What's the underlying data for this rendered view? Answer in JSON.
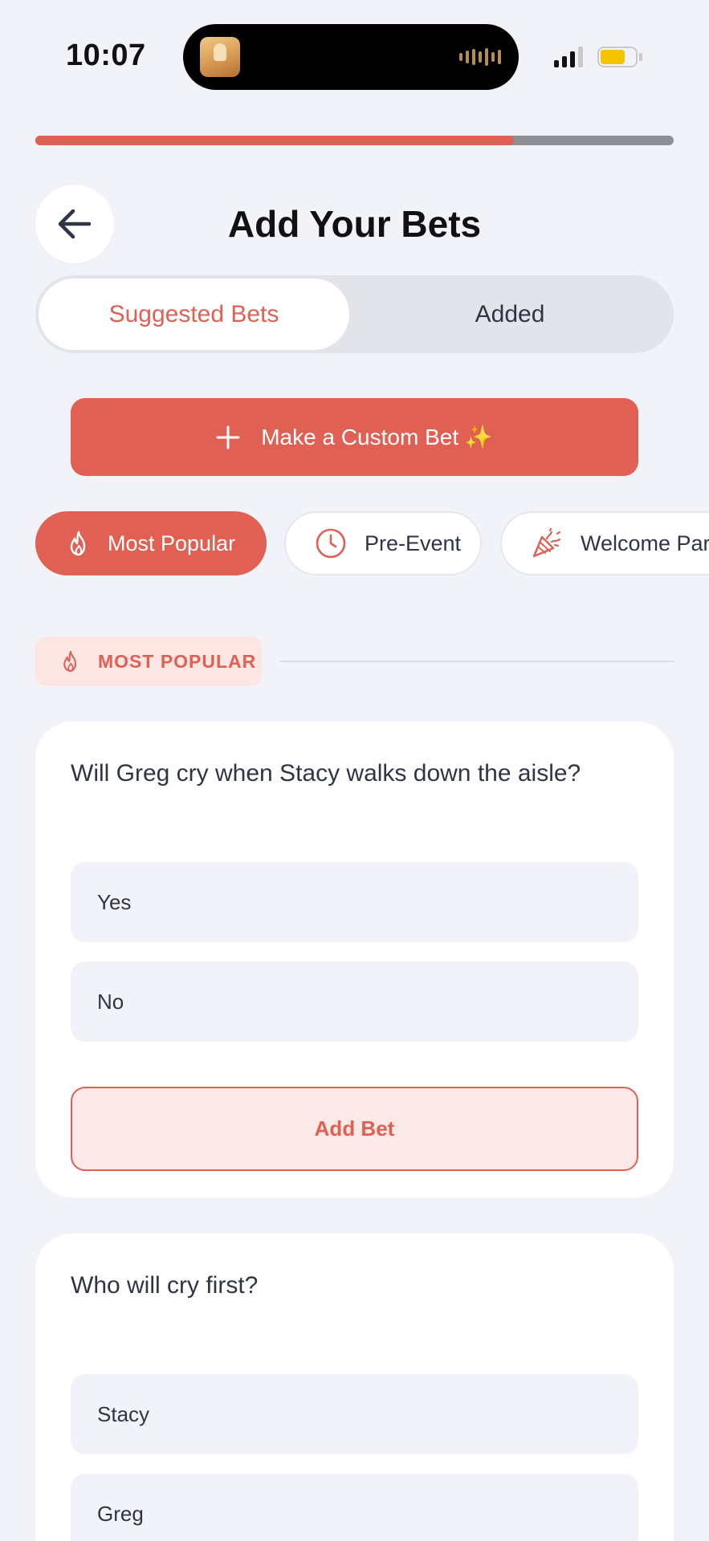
{
  "status_bar": {
    "time": "10:07",
    "battery_color": "#f5c400"
  },
  "progress": {
    "fraction": 0.75,
    "color": "#e06053"
  },
  "header": {
    "title": "Add Your Bets",
    "back_icon": "arrow-left-icon"
  },
  "tabs": [
    {
      "label": "Suggested Bets",
      "active": true
    },
    {
      "label": "Added",
      "active": false
    }
  ],
  "custom_bet": {
    "label": "Make a Custom Bet ✨",
    "icon": "plus-icon"
  },
  "categories": [
    {
      "label": "Most Popular",
      "icon": "flame-icon",
      "active": true
    },
    {
      "label": "Pre-Event",
      "icon": "clock-icon",
      "active": false
    },
    {
      "label": "Welcome Party",
      "icon": "party-popper-icon",
      "active": false
    }
  ],
  "section": {
    "label": "MOST POPULAR",
    "icon": "flame-icon"
  },
  "bets": [
    {
      "question": "Will Greg cry when Stacy walks down the aisle?",
      "options": [
        "Yes",
        "No"
      ],
      "add_label": "Add Bet"
    },
    {
      "question": "Who will cry first?",
      "options": [
        "Stacy",
        "Greg"
      ]
    }
  ],
  "colors": {
    "accent": "#e06053",
    "background": "#f2f3f9",
    "accent_light": "#fbe6e3"
  }
}
